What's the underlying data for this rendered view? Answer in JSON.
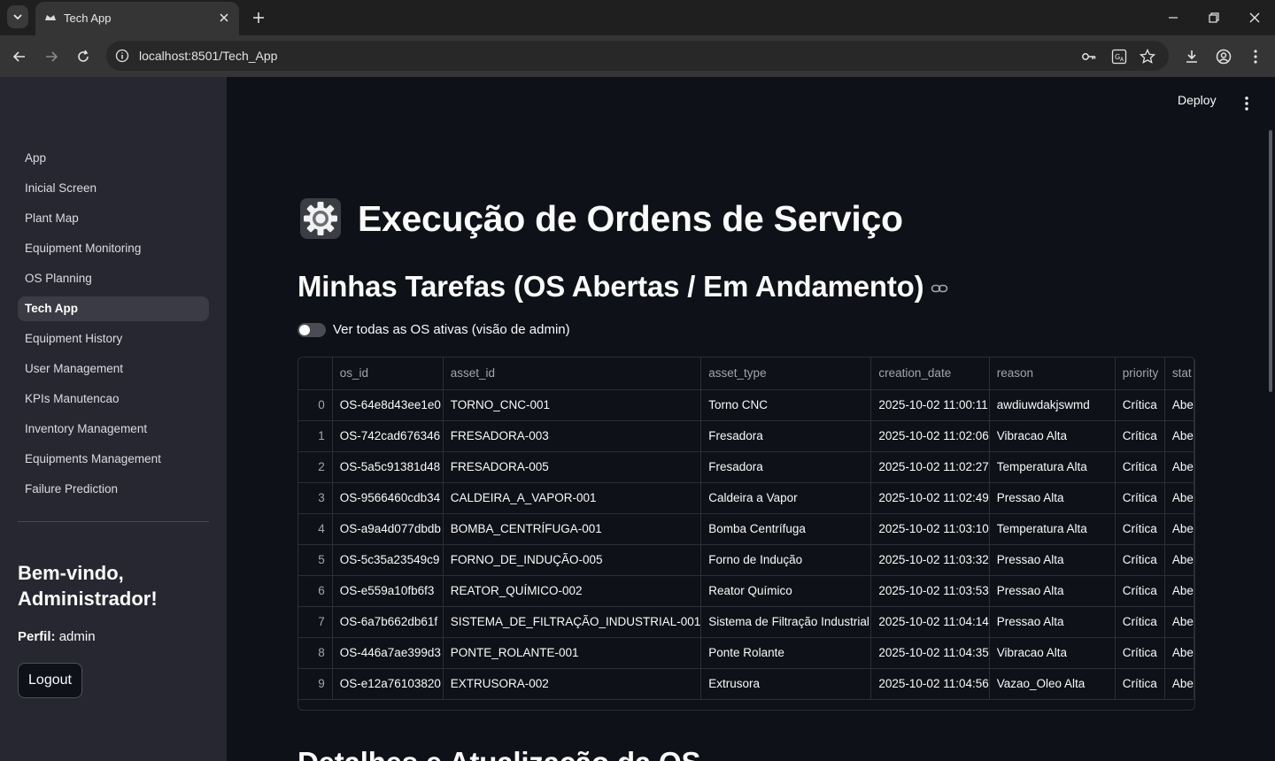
{
  "browser": {
    "tab_title": "Tech App",
    "url": "localhost:8501/Tech_App"
  },
  "sidebar": {
    "items": [
      {
        "label": "App",
        "active": false
      },
      {
        "label": "Inicial Screen",
        "active": false
      },
      {
        "label": "Plant Map",
        "active": false
      },
      {
        "label": "Equipment Monitoring",
        "active": false
      },
      {
        "label": "OS Planning",
        "active": false
      },
      {
        "label": "Tech App",
        "active": true
      },
      {
        "label": "Equipment History",
        "active": false
      },
      {
        "label": "User Management",
        "active": false
      },
      {
        "label": "KPIs Manutencao",
        "active": false
      },
      {
        "label": "Inventory Management",
        "active": false
      },
      {
        "label": "Equipments Management",
        "active": false
      },
      {
        "label": "Failure Prediction",
        "active": false
      }
    ],
    "welcome": "Bem-vindo, Administrador!",
    "profile_label": "Perfil:",
    "profile_value": "admin",
    "logout_label": "Logout"
  },
  "header": {
    "deploy_label": "Deploy"
  },
  "main": {
    "title": "Execução de Ordens de Serviço",
    "subtitle": "Minhas Tarefas (OS Abertas / Em Andamento)",
    "toggle_label": "Ver todas as OS ativas (visão de admin)",
    "toggle_on": false,
    "next_section_title": "Detalhes e Atualização da OS"
  },
  "table": {
    "columns": [
      "os_id",
      "asset_id",
      "asset_type",
      "creation_date",
      "reason",
      "priority",
      "stat"
    ],
    "rows": [
      [
        "0",
        "OS-64e8d43ee1e0",
        "TORNO_CNC-001",
        "Torno CNC",
        "2025-10-02 11:00:11",
        "awdiuwdakjswmd",
        "Crítica",
        "Abe"
      ],
      [
        "1",
        "OS-742cad676346",
        "FRESADORA-003",
        "Fresadora",
        "2025-10-02 11:02:06",
        "Vibracao Alta",
        "Crítica",
        "Abe"
      ],
      [
        "2",
        "OS-5a5c91381d48",
        "FRESADORA-005",
        "Fresadora",
        "2025-10-02 11:02:27",
        "Temperatura Alta",
        "Crítica",
        "Abe"
      ],
      [
        "3",
        "OS-9566460cdb34",
        "CALDEIRA_A_VAPOR-001",
        "Caldeira a Vapor",
        "2025-10-02 11:02:49",
        "Pressao Alta",
        "Crítica",
        "Abe"
      ],
      [
        "4",
        "OS-a9a4d077dbdb",
        "BOMBA_CENTRÍFUGA-001",
        "Bomba Centrífuga",
        "2025-10-02 11:03:10",
        "Temperatura Alta",
        "Crítica",
        "Abe"
      ],
      [
        "5",
        "OS-5c35a23549c9",
        "FORNO_DE_INDUÇÃO-005",
        "Forno de Indução",
        "2025-10-02 11:03:32",
        "Pressao Alta",
        "Crítica",
        "Abe"
      ],
      [
        "6",
        "OS-e559a10fb6f3",
        "REATOR_QUÍMICO-002",
        "Reator Químico",
        "2025-10-02 11:03:53",
        "Pressao Alta",
        "Crítica",
        "Abe"
      ],
      [
        "7",
        "OS-6a7b662db61f",
        "SISTEMA_DE_FILTRAÇÃO_INDUSTRIAL-001",
        "Sistema de Filtração Industrial",
        "2025-10-02 11:04:14",
        "Pressao Alta",
        "Crítica",
        "Abe"
      ],
      [
        "8",
        "OS-446a7ae399d3",
        "PONTE_ROLANTE-001",
        "Ponte Rolante",
        "2025-10-02 11:04:35",
        "Vibracao Alta",
        "Crítica",
        "Abe"
      ],
      [
        "9",
        "OS-e12a76103820",
        "EXTRUSORA-002",
        "Extrusora",
        "2025-10-02 11:04:56",
        "Vazao_Oleo Alta",
        "Crítica",
        "Abe"
      ]
    ]
  },
  "icons": {
    "tab_list": "chevron-down-icon",
    "favicon": "streamlit-crown-icon",
    "page_icon": "gear-icon",
    "header_link": "link-icon"
  },
  "colors": {
    "background": "#0e1117",
    "sidebar": "#262730",
    "active_nav": "#3a3b45",
    "text": "#fafafa",
    "muted": "#a3a5ae"
  }
}
